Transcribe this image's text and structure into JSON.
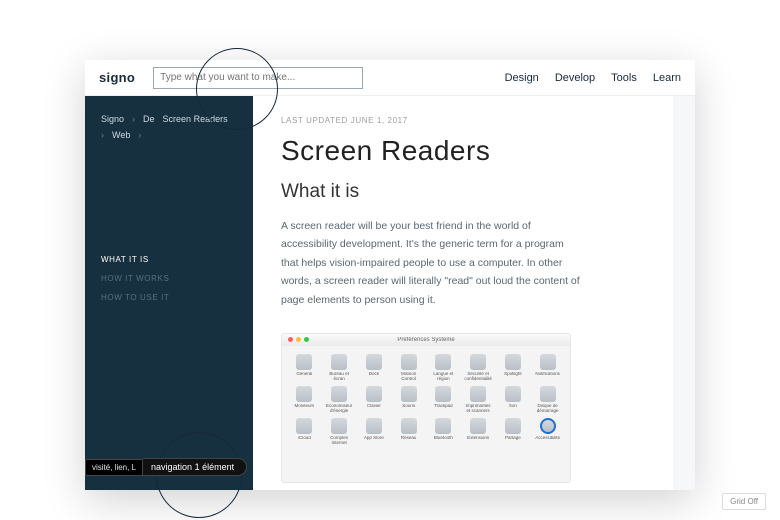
{
  "topbar": {
    "logo": "signo",
    "search_placeholder": "Type what you want to make...",
    "nav": [
      "Design",
      "Develop",
      "Tools",
      "Learn"
    ]
  },
  "sidebar": {
    "crumbs": [
      "Signo",
      "De",
      "Screen Readers",
      "Web"
    ],
    "toc": [
      {
        "label": "WHAT IT IS",
        "active": true
      },
      {
        "label": "HOW IT WORKS",
        "active": false
      },
      {
        "label": "HOW TO USE IT",
        "active": false
      }
    ]
  },
  "main": {
    "updated": "LAST UPDATED JUNE 1, 2017",
    "h1": "Screen Readers",
    "h2": "What it is",
    "paragraph": "A screen reader will be your best friend in the world of accessibility development. It's the generic term for a program that helps vision-impaired people to use a computer. In other words, a screen reader will literally \"read\" out loud the content of page elements to person using it.",
    "figure_title": "Préférences Système",
    "apps": [
      "Général",
      "Bureau et écran",
      "Dock",
      "Mission Control",
      "Langue et région",
      "Sécurité et confidentialité",
      "Spotlight",
      "Notifications",
      "Moniteurs",
      "Économiseur d'énergie",
      "Clavier",
      "Souris",
      "Trackpad",
      "Imprimantes et scanners",
      "Son",
      "Disque de démarrage",
      "iCloud",
      "Comptes Internet",
      "App Store",
      "Réseau",
      "Bluetooth",
      "Extensions",
      "Partage",
      "Accessibilité"
    ],
    "highlight_index": 23
  },
  "sr_caption": {
    "seg1": "visité, lien, L",
    "seg2": "navigation  1 élément"
  },
  "grid_button": "Grid Off"
}
